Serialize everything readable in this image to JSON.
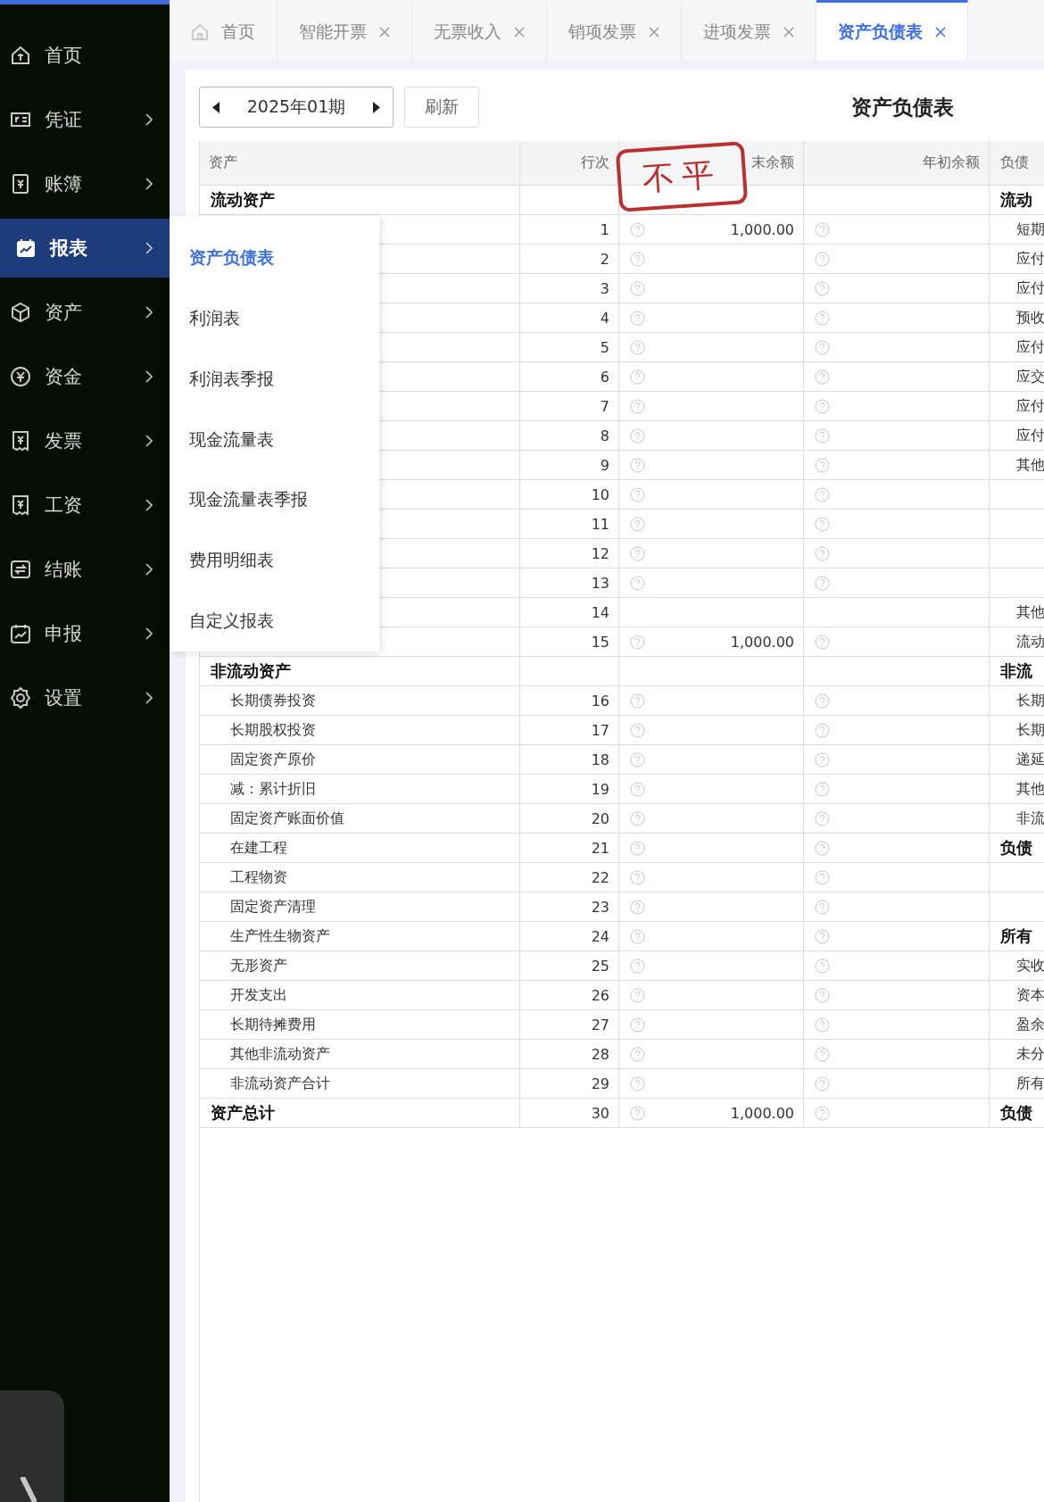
{
  "sidebar": {
    "items": [
      {
        "label": "首页",
        "expandable": false,
        "selected": false
      },
      {
        "label": "凭证",
        "expandable": true,
        "selected": false
      },
      {
        "label": "账簿",
        "expandable": true,
        "selected": false
      },
      {
        "label": "报表",
        "expandable": true,
        "selected": true
      },
      {
        "label": "资产",
        "expandable": true,
        "selected": false
      },
      {
        "label": "资金",
        "expandable": true,
        "selected": false
      },
      {
        "label": "发票",
        "expandable": true,
        "selected": false
      },
      {
        "label": "工资",
        "expandable": true,
        "selected": false
      },
      {
        "label": "结账",
        "expandable": true,
        "selected": false
      },
      {
        "label": "申报",
        "expandable": true,
        "selected": false
      },
      {
        "label": "设置",
        "expandable": true,
        "selected": false
      }
    ]
  },
  "submenu": {
    "items": [
      {
        "label": "资产负债表",
        "selected": true
      },
      {
        "label": "利润表",
        "selected": false
      },
      {
        "label": "利润表季报",
        "selected": false
      },
      {
        "label": "现金流量表",
        "selected": false
      },
      {
        "label": "现金流量表季报",
        "selected": false
      },
      {
        "label": "费用明细表",
        "selected": false
      },
      {
        "label": "自定义报表",
        "selected": false
      }
    ]
  },
  "tabs": [
    {
      "label": "首页",
      "closable": false,
      "selected": false
    },
    {
      "label": "智能开票",
      "closable": true,
      "selected": false
    },
    {
      "label": "无票收入",
      "closable": true,
      "selected": false
    },
    {
      "label": "销项发票",
      "closable": true,
      "selected": false
    },
    {
      "label": "进项发票",
      "closable": true,
      "selected": false
    },
    {
      "label": "资产负债表",
      "closable": true,
      "selected": true
    }
  ],
  "toolbar": {
    "period": "2025年01期",
    "refresh": "刷新",
    "title": "资产负债表"
  },
  "stamp": "不平",
  "table": {
    "columns": [
      "资产",
      "行次",
      "末余额",
      "年初余额",
      "负债"
    ],
    "rows": [
      {
        "kind": "section",
        "asset": "流动资产",
        "help": false,
        "liability": {
          "kind": "section",
          "text": "流动"
        }
      },
      {
        "kind": "item",
        "line": "1",
        "end": "1,000.00",
        "help": true,
        "liability": {
          "kind": "item",
          "text": "短期"
        }
      },
      {
        "kind": "item",
        "line": "2",
        "help": true,
        "liability": {
          "kind": "item",
          "text": "应付"
        }
      },
      {
        "kind": "item",
        "line": "3",
        "help": true,
        "liability": {
          "kind": "item",
          "text": "应付"
        }
      },
      {
        "kind": "item",
        "line": "4",
        "help": true,
        "liability": {
          "kind": "item",
          "text": "预收"
        }
      },
      {
        "kind": "item",
        "line": "5",
        "help": true,
        "liability": {
          "kind": "item",
          "text": "应付"
        }
      },
      {
        "kind": "item",
        "line": "6",
        "help": true,
        "liability": {
          "kind": "item",
          "text": "应交"
        }
      },
      {
        "kind": "item",
        "line": "7",
        "help": true,
        "liability": {
          "kind": "item",
          "text": "应付"
        }
      },
      {
        "kind": "item",
        "line": "8",
        "help": true,
        "liability": {
          "kind": "item",
          "text": "应付"
        }
      },
      {
        "kind": "item",
        "line": "9",
        "help": true,
        "liability": {
          "kind": "item",
          "text": "其他"
        }
      },
      {
        "kind": "item",
        "line": "10",
        "help": true
      },
      {
        "kind": "item",
        "line": "11",
        "help": true
      },
      {
        "kind": "item",
        "line": "12",
        "help": true
      },
      {
        "kind": "item",
        "line": "13",
        "help": true
      },
      {
        "kind": "item",
        "line": "14",
        "help": false,
        "liability": {
          "kind": "item",
          "text": "其他"
        }
      },
      {
        "kind": "item",
        "line": "15",
        "end": "1,000.00",
        "help": true,
        "liability": {
          "kind": "item",
          "text": "流动"
        }
      },
      {
        "kind": "section",
        "asset": "非流动资产",
        "help": false,
        "liability": {
          "kind": "section",
          "text": "非流"
        }
      },
      {
        "kind": "item",
        "asset": "长期债券投资",
        "line": "16",
        "help": true,
        "liability": {
          "kind": "item",
          "text": "长期"
        }
      },
      {
        "kind": "item",
        "asset": "长期股权投资",
        "line": "17",
        "help": true,
        "liability": {
          "kind": "item",
          "text": "长期"
        }
      },
      {
        "kind": "item",
        "asset": "固定资产原价",
        "line": "18",
        "help": true,
        "liability": {
          "kind": "item",
          "text": "递延"
        }
      },
      {
        "kind": "item",
        "asset": "减：累计折旧",
        "line": "19",
        "help": true,
        "liability": {
          "kind": "item",
          "text": "其他"
        }
      },
      {
        "kind": "item",
        "asset": "固定资产账面价值",
        "line": "20",
        "help": true,
        "liability": {
          "kind": "item",
          "text": "非流"
        }
      },
      {
        "kind": "item",
        "asset": "在建工程",
        "line": "21",
        "help": true,
        "liability": {
          "kind": "section",
          "text": "负债"
        }
      },
      {
        "kind": "item",
        "asset": "工程物资",
        "line": "22",
        "help": true
      },
      {
        "kind": "item",
        "asset": "固定资产清理",
        "line": "23",
        "help": true
      },
      {
        "kind": "item",
        "asset": "生产性生物资产",
        "line": "24",
        "help": true,
        "liability": {
          "kind": "section",
          "text": "所有"
        }
      },
      {
        "kind": "item",
        "asset": "无形资产",
        "line": "25",
        "help": true,
        "liability": {
          "kind": "item",
          "text": "实收"
        }
      },
      {
        "kind": "item",
        "asset": "开发支出",
        "line": "26",
        "help": true,
        "liability": {
          "kind": "item",
          "text": "资本"
        }
      },
      {
        "kind": "item",
        "asset": "长期待摊费用",
        "line": "27",
        "help": true,
        "liability": {
          "kind": "item",
          "text": "盈余"
        }
      },
      {
        "kind": "item",
        "asset": "其他非流动资产",
        "line": "28",
        "help": true,
        "liability": {
          "kind": "item",
          "text": "未分"
        }
      },
      {
        "kind": "item",
        "asset": "非流动资产合计",
        "line": "29",
        "help": true,
        "liability": {
          "kind": "item",
          "text": "所有"
        }
      },
      {
        "kind": "total",
        "asset": "资产总计",
        "line": "30",
        "end": "1,000.00",
        "help": true,
        "liability": {
          "kind": "section",
          "text": "负债"
        }
      }
    ]
  }
}
